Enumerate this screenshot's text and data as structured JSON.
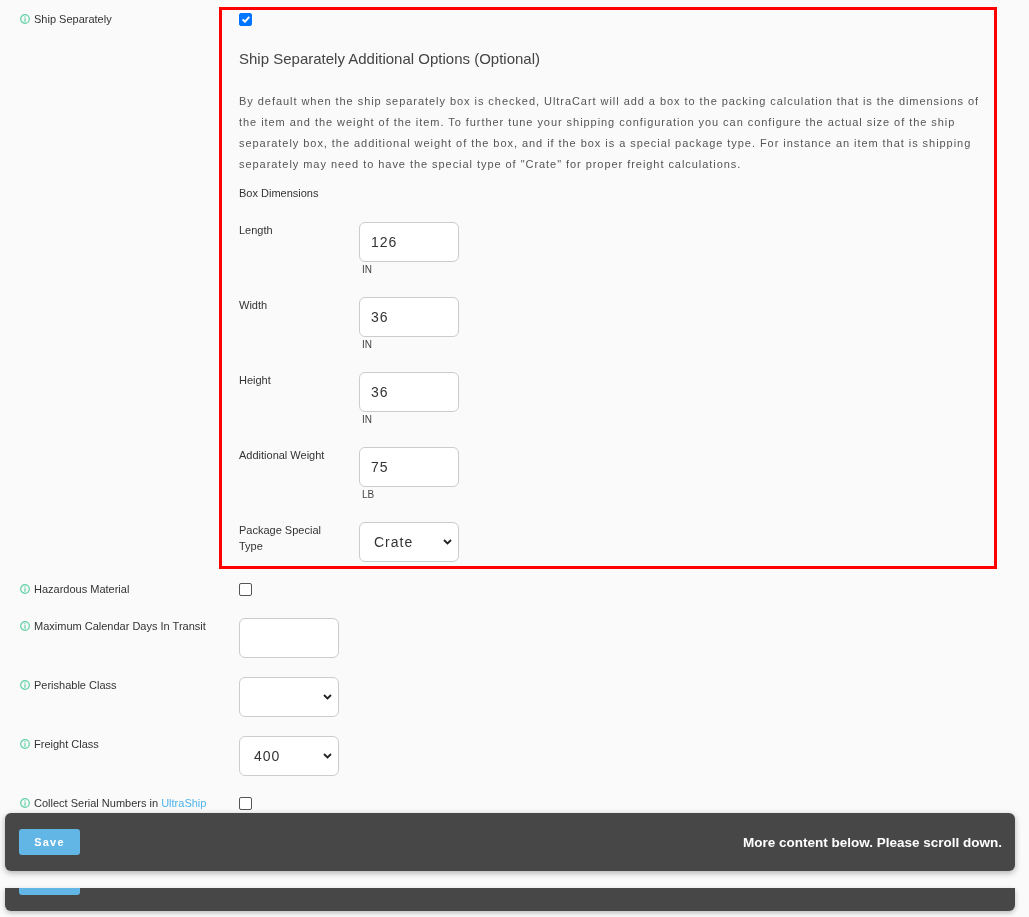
{
  "fields": [
    {
      "kind": "checkbox",
      "label": "Ship Separately",
      "checked": true,
      "options_panel": {
        "highlighted": true,
        "title": "Ship Separately Additional Options (Optional)",
        "description": "By default when the ship separately box is checked, UltraCart will add a box to the packing calculation that is the dimensions of the item and the weight of the item. To further tune your shipping configuration you can configure the actual size of the ship separately box, the additional weight of the box, and if the box is a special package type. For instance an item that is shipping separately may need to have the special type of \"Crate\" for proper freight calculations.",
        "section_label": "Box Dimensions",
        "fields": [
          {
            "kind": "input",
            "label": "Length",
            "value": "126",
            "unit": "IN"
          },
          {
            "kind": "input",
            "label": "Width",
            "value": "36",
            "unit": "IN"
          },
          {
            "kind": "input",
            "label": "Height",
            "value": "36",
            "unit": "IN"
          },
          {
            "kind": "input",
            "label": "Additional Weight",
            "value": "75",
            "unit": "LB"
          },
          {
            "kind": "select",
            "label": "Package Special Type",
            "value": "Crate"
          }
        ]
      }
    },
    {
      "kind": "checkbox",
      "label": "Hazardous Material",
      "checked": false
    },
    {
      "kind": "input",
      "label": "Maximum Calendar Days In Transit"
    },
    {
      "kind": "select",
      "label": "Perishable Class"
    },
    {
      "kind": "select",
      "label": "Freight Class",
      "value": "400"
    },
    {
      "kind": "checkbox",
      "label": "Collect Serial Numbers in",
      "link": "UltraShip",
      "checked": false
    }
  ],
  "save_bar": {
    "button": "Save",
    "message": "More content below. Please scroll down."
  }
}
